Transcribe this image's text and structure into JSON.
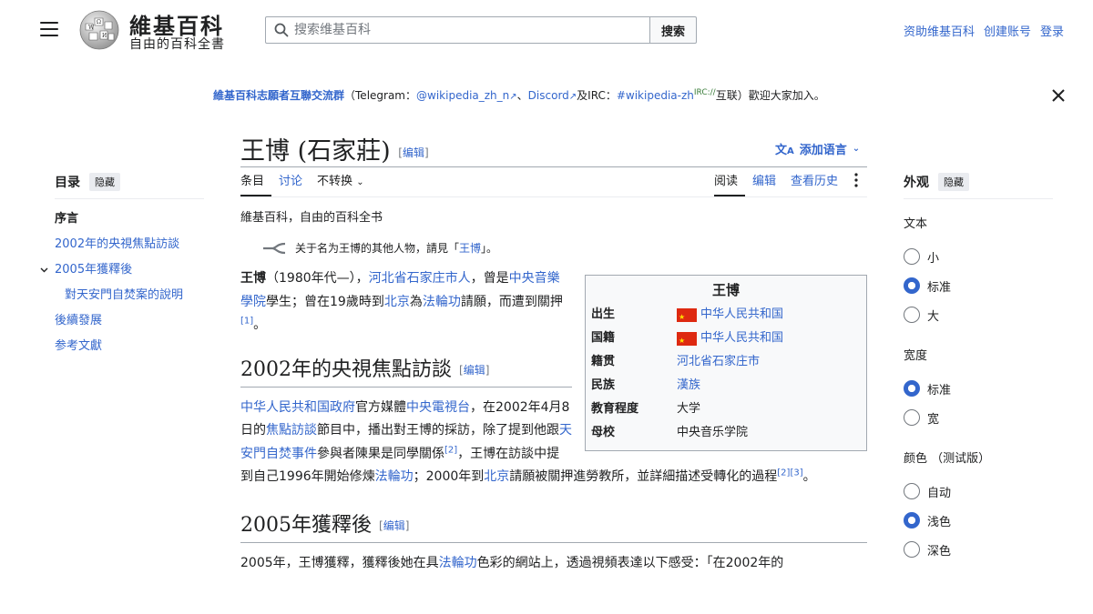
{
  "header": {
    "logo_title": "維基百科",
    "logo_tagline": "自由的百科全書",
    "search_placeholder": "搜索维基百科",
    "search_button": "搜索",
    "user_links": [
      "资助维基百科",
      "创建账号",
      "登录"
    ]
  },
  "banner": {
    "main_link": "維基百科志願者互聯交流群",
    "p1": "（Telegram：",
    "telegram": "@wikipedia_zh_n",
    "sep1": "、",
    "discord": "Discord",
    "and": "及IRC：",
    "irc": "#wikipedia-zh",
    "irc_sup": "IRC://",
    "tail": "互联）歡迎大家加入。"
  },
  "page": {
    "title": "王博 (石家莊)",
    "edit": "编辑",
    "add_languages": "添加语言",
    "tabs_left": [
      "条目",
      "讨论",
      "不转换"
    ],
    "tabs_right": [
      "阅读",
      "编辑",
      "查看历史"
    ],
    "tagline": "維基百科，自由的百科全书",
    "hatnote_prefix": "关于名为王博的其他人物，請見「",
    "hatnote_link": "王博",
    "hatnote_suffix": "」。"
  },
  "infobox": {
    "title": "王博",
    "rows": [
      {
        "k": "出生",
        "v": "中华人民共和国",
        "flag": true
      },
      {
        "k": "国籍",
        "v": "中华人民共和国",
        "flag": true
      },
      {
        "k": "籍贯",
        "v": "河北省石家庄市",
        "flag": false
      },
      {
        "k": "民族",
        "v": "漢族",
        "flag": false
      },
      {
        "k": "教育程度",
        "v": "大学",
        "flag": false,
        "plain": true
      },
      {
        "k": "母校",
        "v": "中央音乐学院",
        "flag": false,
        "plain": true
      }
    ]
  },
  "article": {
    "intro": {
      "name": "王博",
      "t1": "（1980年代—），",
      "l1": "河北省石家庄市人",
      "t2": "，曾是",
      "l2": "中央音樂學院",
      "t3": "學生；曾在19歲時到",
      "l3": "北京",
      "t4": "為",
      "l4": "法輪功",
      "t5": "請願，而遭到關押",
      "ref1": "[1]",
      "t6": "。"
    },
    "s1_title": "2002年的央視焦點訪談",
    "s1": {
      "l1": "中华人民共和国政府",
      "t1": "官方媒體",
      "l2": "中央電視台",
      "t2": "，在2002年4月8日的",
      "l3": "焦點訪談",
      "t3": "節目中，播出對王博的採訪，除了提到他跟",
      "l4": "天安門自焚事件",
      "t4": "參與者陳果是同學關係",
      "ref2": "[2]",
      "t5": "，王博在訪談中提到自己1996年開始修煉",
      "l5": "法輪功",
      "t6": "；2000年到",
      "l6": "北京",
      "t7": "請願被關押進勞教所，並詳細描述受轉化的過程",
      "ref3": "[2]",
      "ref4": "[3]",
      "t8": "。"
    },
    "s2_title": "2005年獲釋後",
    "s2": {
      "t1": "2005年，王博獲釋，獲釋後她在具",
      "l1": "法輪功",
      "t2": "色彩的網站上，透過視頻表達以下感受：「在2002年的"
    }
  },
  "toc": {
    "title": "目录",
    "hide": "隐藏",
    "items": [
      "序言",
      "2002年的央視焦點訪談",
      "2005年獲釋後",
      "對天安門自焚案的說明",
      "後續發展",
      "参考文獻"
    ]
  },
  "appearance": {
    "title": "外观",
    "hide": "隐藏",
    "text_label": "文本",
    "text_options": [
      "小",
      "标准",
      "大"
    ],
    "width_label": "宽度",
    "width_options": [
      "标准",
      "宽"
    ],
    "color_label": "颜色 （测试版）",
    "color_options": [
      "自动",
      "浅色",
      "深色"
    ]
  },
  "colors": {
    "link": "#3366cc",
    "text": "#202122",
    "accent": "#3366cc"
  }
}
